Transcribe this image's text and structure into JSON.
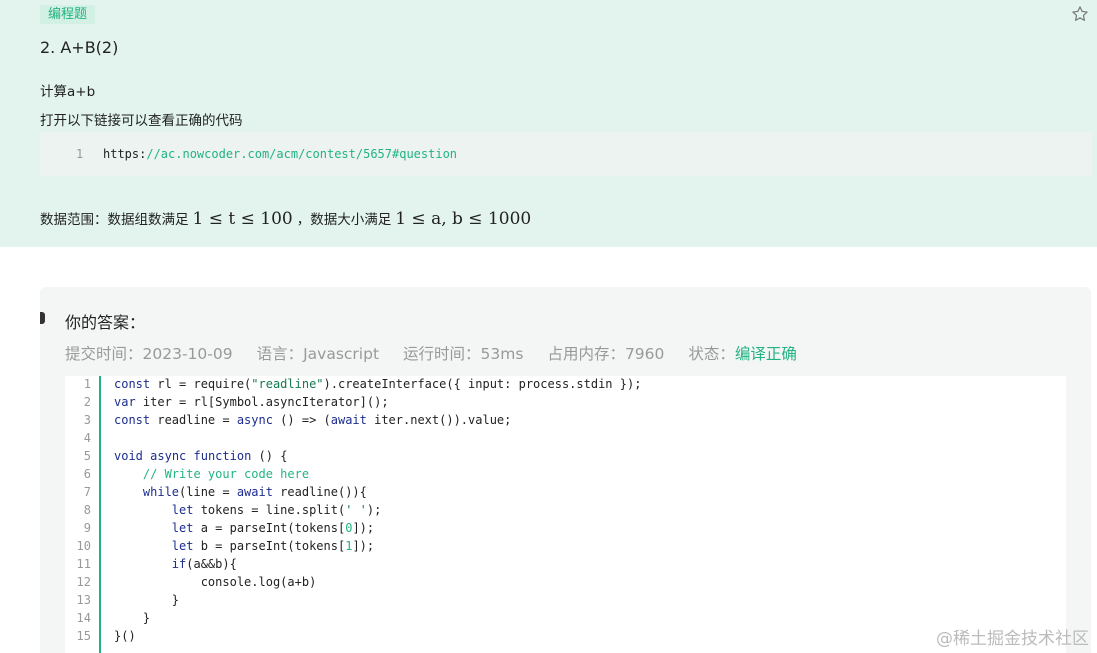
{
  "problem": {
    "tag": "编程题",
    "title": "2. A+B(2)",
    "desc_1": "计算a+b",
    "desc_2": "打开以下链接可以查看正确的代码",
    "link_code": {
      "line_number": "1",
      "prefix": "https:",
      "rest": "//ac.nowcoder.com/acm/contest/5657#question"
    },
    "data_range": {
      "label": "数据范围：数据组数满足",
      "sep": "，数据大小满足",
      "math_1": "1 ≤ t ≤ 100",
      "math_2": "1 ≤ a, b ≤ 1000"
    }
  },
  "answer": {
    "heading": "你的答案：",
    "meta": {
      "submit_time": "提交时间：2023-10-09",
      "language": "语言：Javascript",
      "runtime": "运行时间：53ms",
      "memory": "占用内存：7960",
      "status_label": "状态：",
      "status_value": "编译正确"
    },
    "code_lines": [
      "const rl = require(\"readline\").createInterface({ input: process.stdin });",
      "var iter = rl[Symbol.asyncIterator]();",
      "const readline = async () => (await iter.next()).value;",
      "",
      "void async function () {",
      "    // Write your code here",
      "    while(line = await readline()){",
      "        let tokens = line.split(' ');",
      "        let a = parseInt(tokens[0]);",
      "        let b = parseInt(tokens[1]);",
      "        if(a&&b){",
      "            console.log(a+b)",
      "        }",
      "    }",
      "}()"
    ],
    "line_numbers": [
      "1",
      "2",
      "3",
      "4",
      "5",
      "6",
      "7",
      "8",
      "9",
      "10",
      "11",
      "12",
      "13",
      "14",
      "15"
    ]
  },
  "watermark": "@稀土掘金技术社区",
  "colors": {
    "accent": "#23b383",
    "problem_bg": "#e3f4ee",
    "answer_bg": "#f4f6f5"
  },
  "icons": {
    "favorite": "star-outline-icon"
  }
}
